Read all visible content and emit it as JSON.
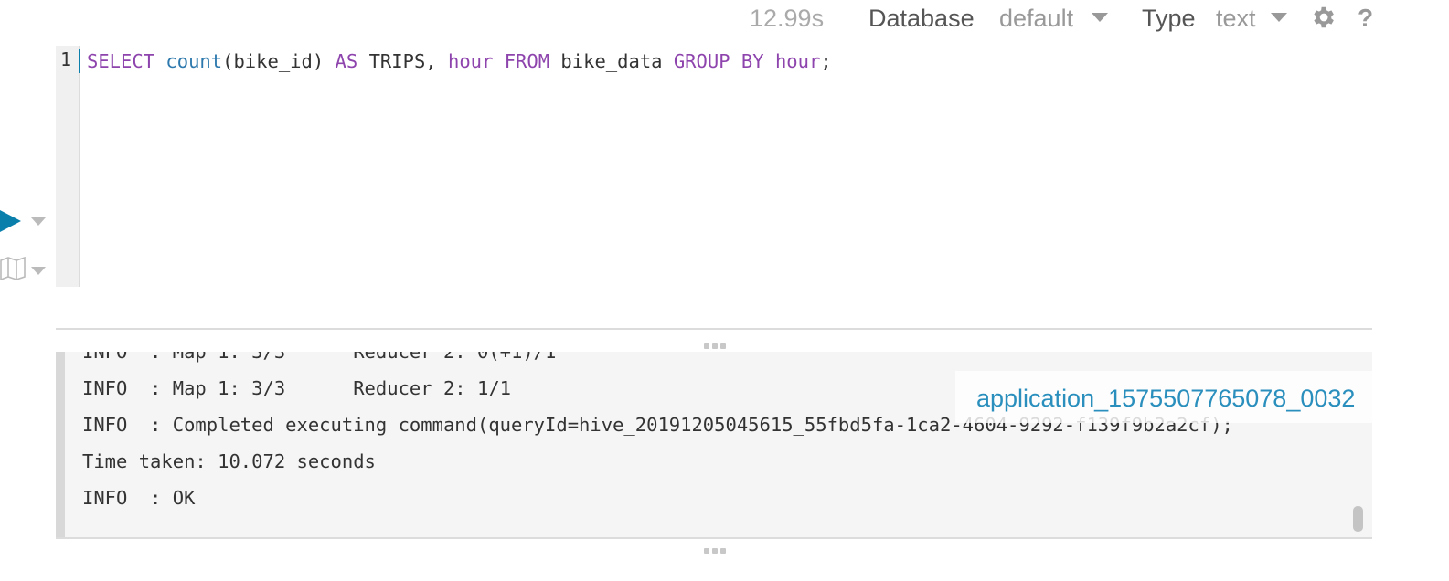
{
  "toolbar": {
    "execution_time": "12.99s",
    "database_label": "Database",
    "database_value": "default",
    "type_label": "Type",
    "type_value": "text",
    "help_label": "?"
  },
  "editor": {
    "line_number": "1",
    "tokens": [
      {
        "text": "SELECT",
        "kind": "kw"
      },
      {
        "text": " ",
        "kind": ""
      },
      {
        "text": "count",
        "kind": "fn"
      },
      {
        "text": "(bike_id) ",
        "kind": ""
      },
      {
        "text": "AS",
        "kind": "kw"
      },
      {
        "text": " TRIPS, ",
        "kind": ""
      },
      {
        "text": "hour",
        "kind": "kw"
      },
      {
        "text": " ",
        "kind": ""
      },
      {
        "text": "FROM",
        "kind": "kw"
      },
      {
        "text": " bike_data ",
        "kind": ""
      },
      {
        "text": "GROUP BY",
        "kind": "kw"
      },
      {
        "text": " ",
        "kind": ""
      },
      {
        "text": "hour",
        "kind": "kw"
      },
      {
        "text": ";",
        "kind": ""
      }
    ]
  },
  "log": {
    "lines": [
      "INFO  : Map 1: 3/3      Reducer 2: 0(+1)/1",
      "INFO  : Map 1: 3/3      Reducer 2: 1/1",
      "INFO  : Completed executing command(queryId=hive_20191205045615_55fbd5fa-1ca2-4604-9292-f139f9b2a2cf);",
      "Time taken: 10.072 seconds",
      "INFO  : OK"
    ],
    "application_link": "application_1575507765078_0032"
  },
  "colors": {
    "accent": "#0b7fab",
    "keyword": "#8e44ad",
    "function": "#2d79ad",
    "link": "#2a8fbd"
  }
}
